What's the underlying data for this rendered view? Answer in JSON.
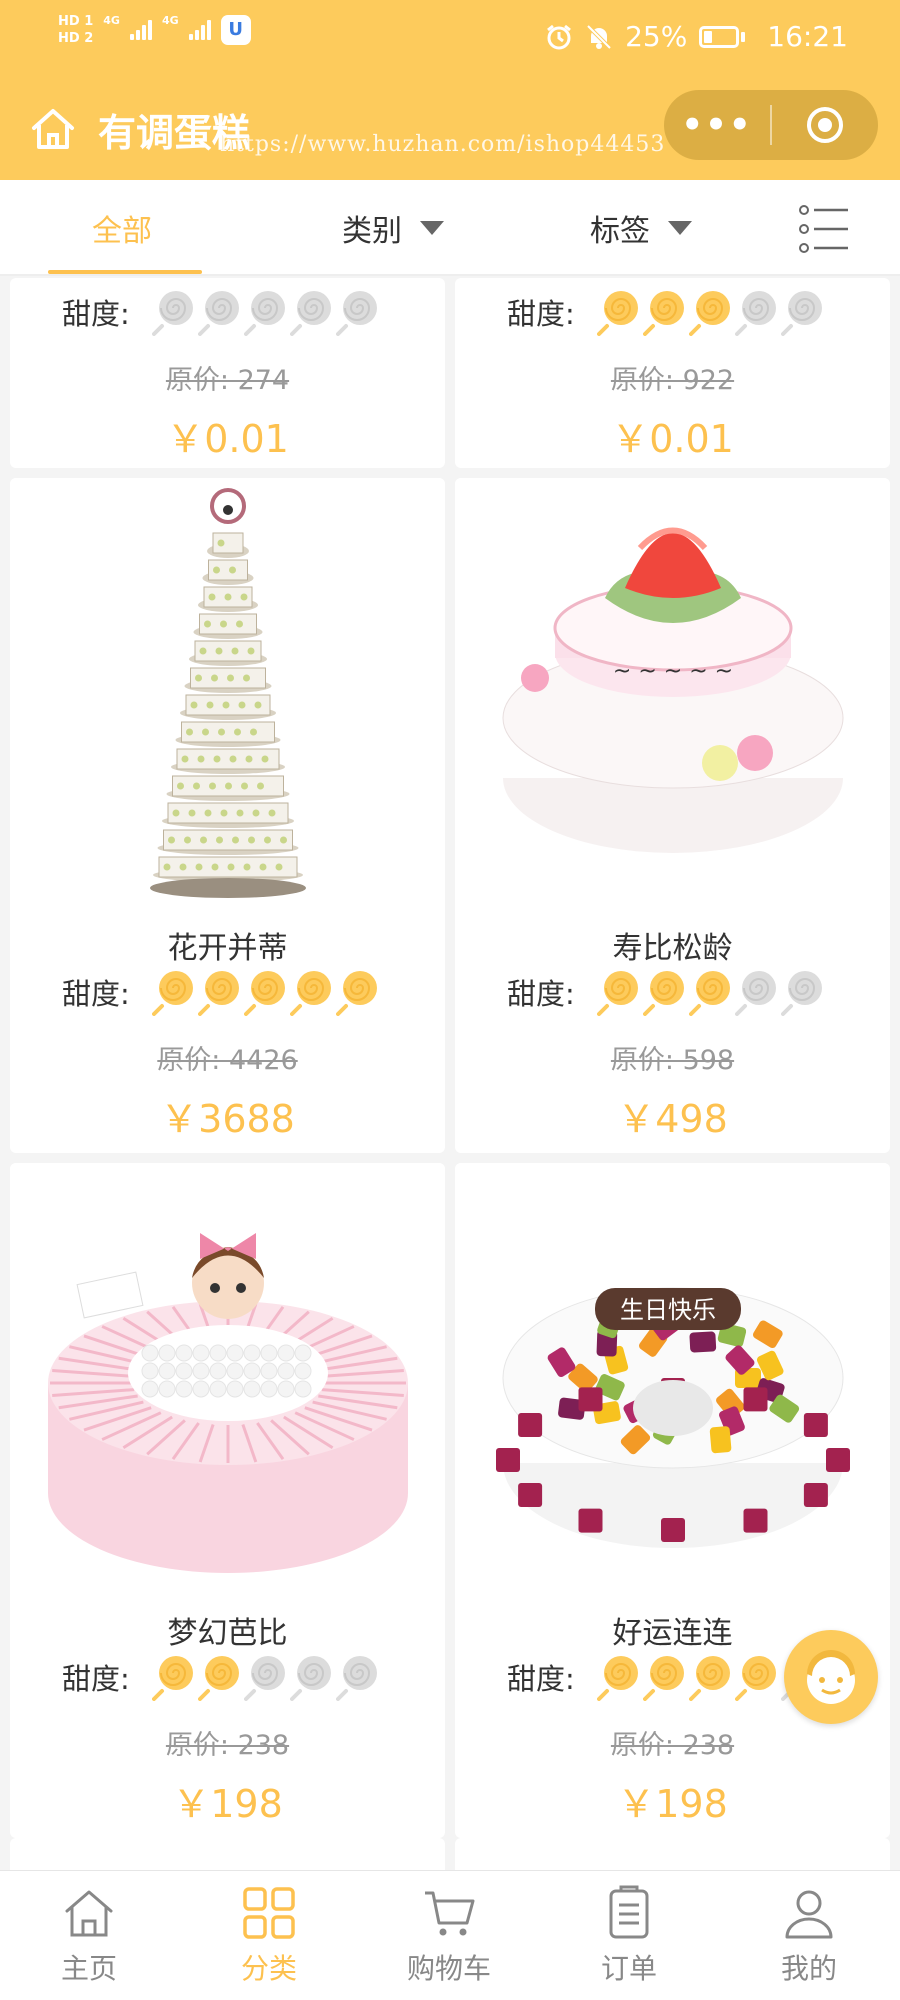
{
  "status_bar": {
    "hd1": "HD 1",
    "hd2": "HD 2",
    "net1": "4G",
    "net2": "4G",
    "app_badge": "U",
    "battery_percent": "25%",
    "battery_level": 0.25,
    "time": "16:21"
  },
  "nav": {
    "title": "有调蛋糕",
    "watermark": "https://www.huzhan.com/ishop44453",
    "more_label": "•••"
  },
  "filters": {
    "all": "全部",
    "category": "类别",
    "tag": "标签"
  },
  "sweet_label": "甜度:",
  "products": [
    {
      "name": "",
      "sweetness": 0,
      "original": "原价: 274",
      "price": "￥0.01"
    },
    {
      "name": "",
      "sweetness": 3,
      "original": "原价: 922",
      "price": "￥0.01"
    },
    {
      "name": "花开并蒂",
      "sweetness": 5,
      "original": "原价: 4426",
      "price": "￥3688",
      "image": "tiered-wedding-cake"
    },
    {
      "name": "寿比松龄",
      "sweetness": 3,
      "original": "原价: 598",
      "price": "￥498",
      "image": "peach-birthday-cake"
    },
    {
      "name": "梦幻芭比",
      "sweetness": 2,
      "original": "原价: 238",
      "price": "￥198",
      "image": "pink-doll-cake"
    },
    {
      "name": "好运连连",
      "sweetness": 4,
      "original": "原价: 238",
      "price": "￥198",
      "image": "fruit-cake",
      "plaque": "生日快乐"
    }
  ],
  "tabs": [
    {
      "label": "主页",
      "icon": "home-icon"
    },
    {
      "label": "分类",
      "icon": "grid-icon",
      "active": true
    },
    {
      "label": "购物车",
      "icon": "cart-icon"
    },
    {
      "label": "订单",
      "icon": "order-icon"
    },
    {
      "label": "我的",
      "icon": "user-icon"
    }
  ],
  "colors": {
    "brand": "#fdcb5c",
    "accent": "#fdc14f",
    "lolli_on": "#fdcb5c",
    "lolli_off": "#dcdcdc"
  }
}
